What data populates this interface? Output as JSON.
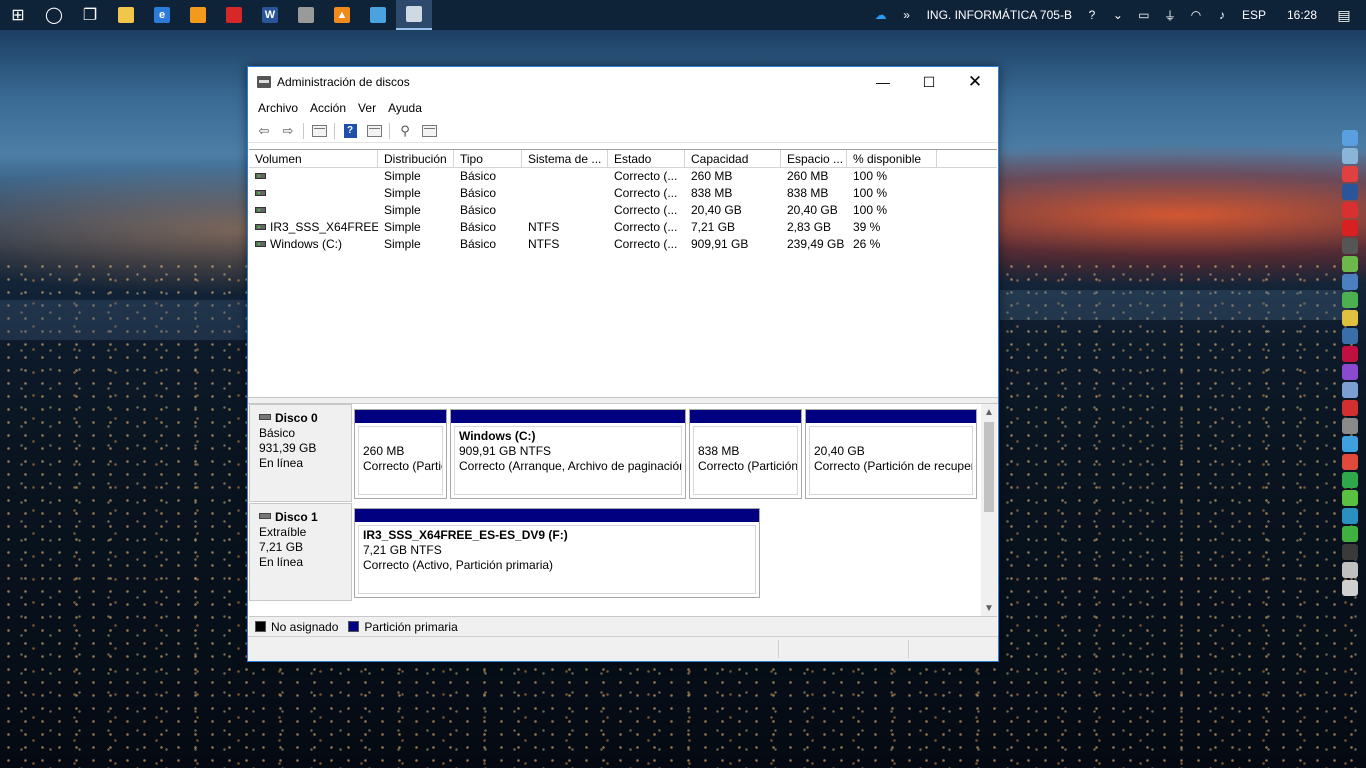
{
  "taskbar": {
    "apps": [
      {
        "name": "start-button",
        "glyph": "⊞",
        "color": "#ffffff"
      },
      {
        "name": "cortana-button",
        "glyph": "◯",
        "color": "#ffffff"
      },
      {
        "name": "task-view-button",
        "glyph": "❐",
        "color": "#ffffff"
      },
      {
        "name": "file-explorer-app",
        "glyph": "",
        "color": "#f2c54b"
      },
      {
        "name": "edge-app",
        "glyph": "e",
        "color": "#2b7bd8"
      },
      {
        "name": "media-player-app",
        "glyph": "",
        "color": "#f39a1c"
      },
      {
        "name": "red-circle-app",
        "glyph": "",
        "color": "#d62828"
      },
      {
        "name": "word-app",
        "glyph": "W",
        "color": "#2a5699"
      },
      {
        "name": "pen-app",
        "glyph": "",
        "color": "#9a9a9a"
      },
      {
        "name": "vlc-app",
        "glyph": "▲",
        "color": "#f08a1c"
      },
      {
        "name": "control-panel-app",
        "glyph": "",
        "color": "#4aa3df"
      },
      {
        "name": "disk-management-app",
        "glyph": "",
        "color": "#cfd8e3",
        "active": true
      }
    ],
    "tray": {
      "network_name": "ING. INFORMÁTICA 705-B",
      "language": "ESP",
      "time": "16:28"
    }
  },
  "window": {
    "title": "Administración de discos",
    "menu": [
      "Archivo",
      "Acción",
      "Ver",
      "Ayuda"
    ],
    "columns": [
      "Volumen",
      "Distribución",
      "Tipo",
      "Sistema de ...",
      "Estado",
      "Capacidad",
      "Espacio ...",
      "% disponible"
    ],
    "volumes": [
      {
        "volumen": "",
        "distribucion": "Simple",
        "tipo": "Básico",
        "sistema": "",
        "estado": "Correcto (...",
        "capacidad": "260 MB",
        "espacio": "260 MB",
        "disponible": "100 %"
      },
      {
        "volumen": "",
        "distribucion": "Simple",
        "tipo": "Básico",
        "sistema": "",
        "estado": "Correcto (...",
        "capacidad": "838 MB",
        "espacio": "838 MB",
        "disponible": "100 %"
      },
      {
        "volumen": "",
        "distribucion": "Simple",
        "tipo": "Básico",
        "sistema": "",
        "estado": "Correcto (...",
        "capacidad": "20,40 GB",
        "espacio": "20,40 GB",
        "disponible": "100 %"
      },
      {
        "volumen": "IR3_SSS_X64FREE_...",
        "distribucion": "Simple",
        "tipo": "Básico",
        "sistema": "NTFS",
        "estado": "Correcto (...",
        "capacidad": "7,21 GB",
        "espacio": "2,83 GB",
        "disponible": "39 %"
      },
      {
        "volumen": "Windows (C:)",
        "distribucion": "Simple",
        "tipo": "Básico",
        "sistema": "NTFS",
        "estado": "Correcto (...",
        "capacidad": "909,91 GB",
        "espacio": "239,49 GB",
        "disponible": "26 %"
      }
    ],
    "disks": [
      {
        "name": "Disco 0",
        "type": "Básico",
        "size": "931,39 GB",
        "status": "En línea",
        "partitions": [
          {
            "title": "",
            "line1": "260 MB",
            "line2": "Correcto (Partic"
          },
          {
            "title": "Windows  (C:)",
            "line1": "909,91 GB NTFS",
            "line2": "Correcto (Arranque, Archivo de paginación"
          },
          {
            "title": "",
            "line1": "838 MB",
            "line2": "Correcto (Partición"
          },
          {
            "title": "",
            "line1": "20,40 GB",
            "line2": "Correcto (Partición de recuper"
          }
        ]
      },
      {
        "name": "Disco 1",
        "type": "Extraíble",
        "size": "7,21 GB",
        "status": "En línea",
        "partitions": [
          {
            "title": "IR3_SSS_X64FREE_ES-ES_DV9  (F:)",
            "line1": "7,21 GB NTFS",
            "line2": "Correcto (Activo, Partición primaria)"
          }
        ]
      }
    ],
    "legend": [
      {
        "label": "No asignado",
        "color": "#000000"
      },
      {
        "label": "Partición primaria",
        "color": "#000080"
      }
    ]
  },
  "side_icons": [
    "#5aa0e0",
    "#8ab4d8",
    "#e04040",
    "#2a5699",
    "#d83030",
    "#d82020",
    "#555555",
    "#6cb84a",
    "#4a7fc0",
    "#4caf50",
    "#e0c040",
    "#3a6ea8",
    "#c01040",
    "#8a4ad0",
    "#7a9fd0",
    "#d03030",
    "#8a8a8a",
    "#3fa0e0",
    "#e04a3a",
    "#2ea84a",
    "#5ac040",
    "#2a90c0",
    "#40b040",
    "#3a3a3a",
    "#c0c0c0",
    "#d0d0d0"
  ]
}
